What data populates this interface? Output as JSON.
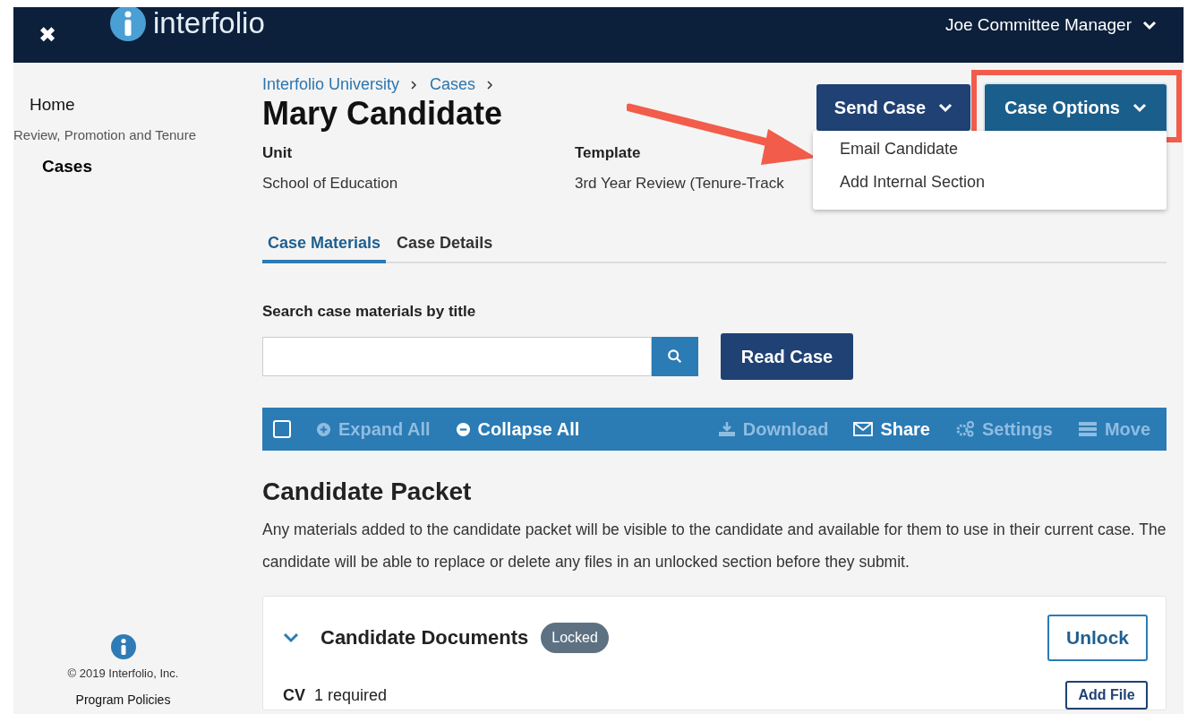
{
  "navbar": {
    "close_icon": "✖",
    "brand": "interfolio",
    "user_menu": "Joe Committee Manager"
  },
  "sidebar": {
    "items": [
      {
        "label": "Home",
        "kind": "link",
        "selected": false
      },
      {
        "label": "Review, Promotion and Tenure",
        "kind": "heading"
      },
      {
        "label": "Cases",
        "kind": "link",
        "selected": true
      }
    ],
    "footer": {
      "copyright": "© 2019 Interfolio, Inc.",
      "link": "Program Policies"
    }
  },
  "breadcrumb": [
    "Interfolio University",
    "Cases"
  ],
  "title": "Mary Candidate",
  "fields": [
    {
      "label": "Unit",
      "value": "School of Education"
    },
    {
      "label": "Template",
      "value": "3rd Year Review (Tenure-Track"
    }
  ],
  "actions": [
    {
      "label": "Send Case",
      "open": false,
      "highlighted": false
    },
    {
      "label": "Case Options",
      "open": true,
      "highlighted": true
    }
  ],
  "dropdown_menu": [
    "Email Candidate",
    "Add Internal Section"
  ],
  "tabs": [
    {
      "label": "Case Materials",
      "selected": true
    },
    {
      "label": "Case Details",
      "selected": false
    }
  ],
  "search": {
    "label": "Search case materials by title"
  },
  "read_button": "Read Case",
  "toolbar": {
    "select_all_checked": false,
    "items": [
      {
        "label": "Expand All",
        "kind": "expand",
        "disabled": true
      },
      {
        "label": "Collapse All",
        "kind": "collapse",
        "disabled": false
      },
      {
        "label": "Download",
        "kind": "download",
        "disabled": true
      },
      {
        "label": "Share",
        "kind": "share",
        "disabled": false
      },
      {
        "label": "Settings",
        "kind": "settings",
        "disabled": true
      },
      {
        "label": "Move",
        "kind": "move",
        "disabled": true
      }
    ]
  },
  "packet": {
    "heading": "Candidate Packet",
    "description": "Any materials added to the candidate packet will be visible to the candidate and available for them to use in their current case. The candidate will be able to replace or delete any files in an unlocked section before they submit."
  },
  "section": {
    "title": "Candidate Documents",
    "expanded": true,
    "badge": "Locked",
    "button": "Unlock",
    "rows": [
      {
        "name": "CV",
        "requirement": "1 required",
        "button": "Add File"
      }
    ]
  }
}
